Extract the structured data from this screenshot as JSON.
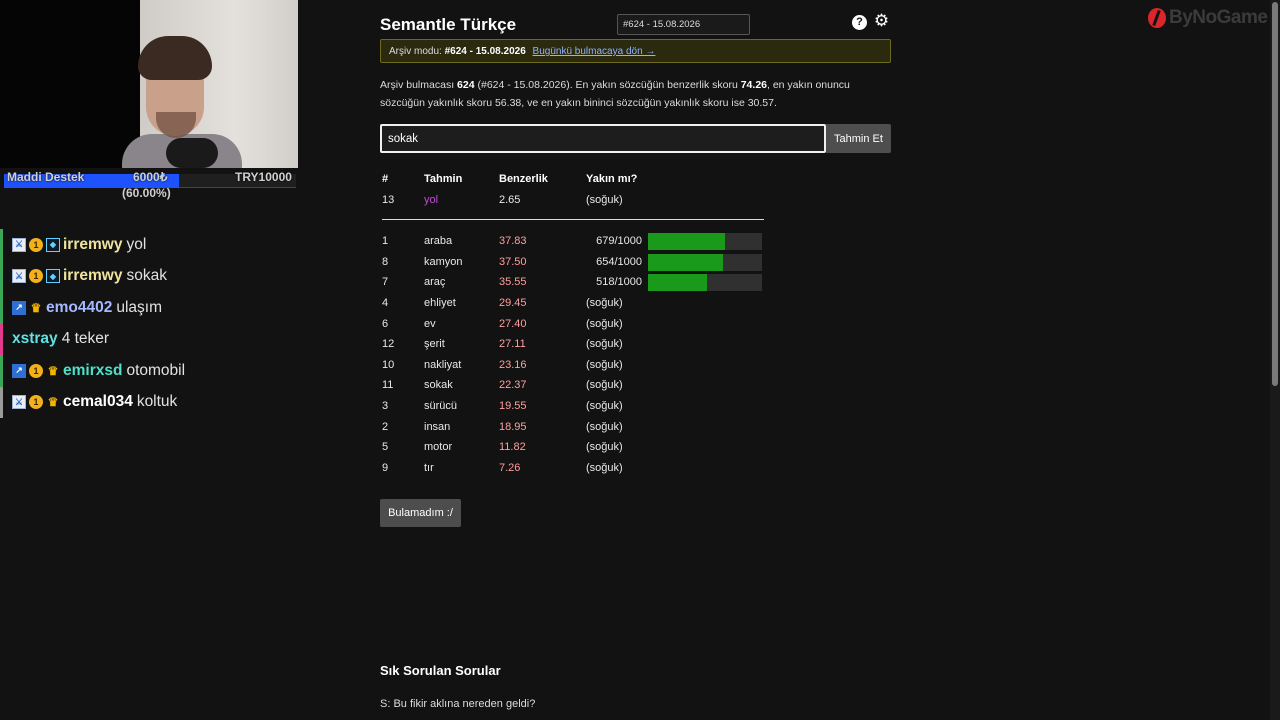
{
  "overlay": {
    "donation": {
      "label": "Maddi Destek",
      "current": "6000₺",
      "goal": "TRY10000",
      "percent_text": "(60.00%)",
      "progress": 0.6
    },
    "chat": [
      {
        "badges": [
          "mod-icon",
          "sub-badge-icon",
          "vip-icon"
        ],
        "user": "irremwy",
        "user_color": "#f0e3a0",
        "message": "yol",
        "border": "green"
      },
      {
        "badges": [
          "mod-icon",
          "sub-badge-icon",
          "vip-icon"
        ],
        "user": "irremwy",
        "user_color": "#f0e3a0",
        "message": "sokak",
        "border": "green"
      },
      {
        "badges": [
          "prediction-icon",
          "crown-icon"
        ],
        "user": "emo4402",
        "user_color": "#a6b8ff",
        "message": "ulaşım",
        "border": "green"
      },
      {
        "badges": [],
        "user": "xstray",
        "user_color": "#5ee3e3",
        "message": "4 teker",
        "border": "pink"
      },
      {
        "badges": [
          "prediction-icon",
          "sub-badge-icon",
          "crown-icon"
        ],
        "user": "emirxsd",
        "user_color": "#4ee0c8",
        "message": "otomobil",
        "border": "green"
      },
      {
        "badges": [
          "mod-icon",
          "sub-badge-icon",
          "crown-icon"
        ],
        "user": "cemal034",
        "user_color": "#ffffff",
        "message": "koltuk",
        "border": "gray"
      }
    ],
    "logo": {
      "text": "ByNoGame",
      "icon": "bynogame-logo-icon"
    }
  },
  "game": {
    "title": "Semantle Türkçe",
    "puzzle_select": "#624 - 15.08.2026",
    "archive_banner": {
      "prefix": "Arşiv modu:",
      "puzzle": "#624 - 15.08.2026",
      "link": "Bugünkü bulmacaya dön →"
    },
    "summary": {
      "p1": "Arşiv bulmacası ",
      "num": "624",
      "p2": " (#624 - 15.08.2026). En yakın sözcüğün benzerlik skoru ",
      "top": "74.26",
      "p3": ", en yakın onuncu sözcüğün yakınlık skoru 56.38, ve en yakın bininci sözcüğün yakınlık skoru ise 30.57."
    },
    "guess_input_value": "sokak",
    "guess_button": "Tahmin Et",
    "table_headers": {
      "num": "#",
      "word": "Tahmin",
      "similarity": "Benzerlik",
      "proximity": "Yakın mı?"
    },
    "last_guess": {
      "num": "13",
      "word": "yol",
      "similarity": "2.65",
      "proximity": "(soğuk)"
    },
    "guesses": [
      {
        "num": "1",
        "word": "araba",
        "similarity": "37.83",
        "proximity": "679/1000",
        "bar": 0.679
      },
      {
        "num": "8",
        "word": "kamyon",
        "similarity": "37.50",
        "proximity": "654/1000",
        "bar": 0.654
      },
      {
        "num": "7",
        "word": "araç",
        "similarity": "35.55",
        "proximity": "518/1000",
        "bar": 0.518
      },
      {
        "num": "4",
        "word": "ehliyet",
        "similarity": "29.45",
        "proximity": "(soğuk)"
      },
      {
        "num": "6",
        "word": "ev",
        "similarity": "27.40",
        "proximity": "(soğuk)"
      },
      {
        "num": "12",
        "word": "şerit",
        "similarity": "27.11",
        "proximity": "(soğuk)"
      },
      {
        "num": "10",
        "word": "nakliyat",
        "similarity": "23.16",
        "proximity": "(soğuk)"
      },
      {
        "num": "11",
        "word": "sokak",
        "similarity": "22.37",
        "proximity": "(soğuk)"
      },
      {
        "num": "3",
        "word": "sürücü",
        "similarity": "19.55",
        "proximity": "(soğuk)"
      },
      {
        "num": "2",
        "word": "insan",
        "similarity": "18.95",
        "proximity": "(soğuk)"
      },
      {
        "num": "5",
        "word": "motor",
        "similarity": "11.82",
        "proximity": "(soğuk)"
      },
      {
        "num": "9",
        "word": "tır",
        "similarity": "7.26",
        "proximity": "(soğuk)"
      }
    ],
    "give_up_button": "Bulamadım :/",
    "faq_title": "Sık Sorulan Sorular",
    "faq_q1": "S: Bu fikir aklına nereden geldi?"
  }
}
